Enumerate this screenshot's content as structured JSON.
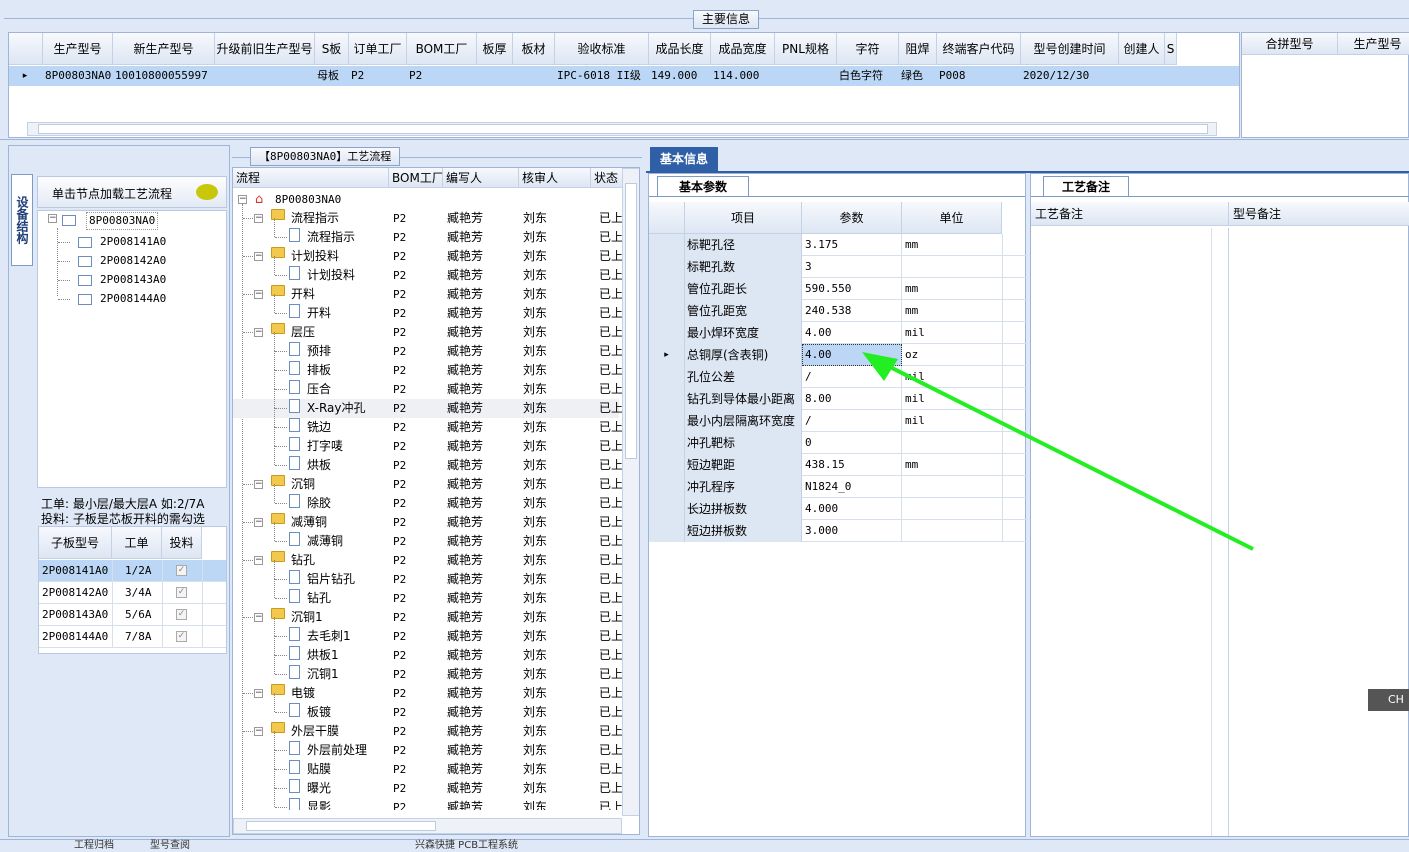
{
  "main_info": {
    "title": "主要信息",
    "columns": [
      "生产型号",
      "新生产型号",
      "升级前旧生产型号",
      "S板",
      "订单工厂",
      "BOM工厂",
      "板厚",
      "板材",
      "验收标准",
      "成品长度",
      "成品宽度",
      "PNL规格",
      "字符",
      "阻焊",
      "终端客户代码",
      "型号创建时间",
      "创建人",
      "S"
    ],
    "row": [
      "8P00803NA0",
      "10010800055997",
      "",
      "母板",
      "P2",
      "P2",
      "",
      "",
      "IPC-6018 II级",
      "149.000",
      "114.000",
      "",
      "白色字符",
      "绿色",
      "P008",
      "2020/12/30",
      "",
      ""
    ],
    "merge_columns": [
      "合拼型号",
      "生产型号"
    ]
  },
  "left": {
    "vtab": "设备结构",
    "hint": "单击节点加载工艺流程",
    "tree_root": "8P00803NA0",
    "tree_children": [
      "2P008141A0",
      "2P008142A0",
      "2P008143A0",
      "2P008144A0"
    ],
    "note1": "工单: 最小层/最大层A 如:2/7A",
    "note2": "投料: 子板是芯板开料的需勾选",
    "sub_headers": [
      "子板型号",
      "工单",
      "投料"
    ],
    "sub_rows": [
      [
        "2P008141A0",
        "1/2A"
      ],
      [
        "2P008142A0",
        "3/4A"
      ],
      [
        "2P008143A0",
        "5/6A"
      ],
      [
        "2P008144A0",
        "7/8A"
      ]
    ]
  },
  "flow": {
    "title": "【8P00803NA0】工艺流程",
    "headers": [
      "流程",
      "BOM工厂",
      "编写人",
      "核审人",
      "状态"
    ],
    "root": "8P00803NA0",
    "rows": [
      {
        "n": "流程指示",
        "l": 1,
        "f": 1
      },
      {
        "n": "流程指示",
        "l": 2
      },
      {
        "n": "计划投料",
        "l": 1,
        "f": 1
      },
      {
        "n": "计划投料",
        "l": 2
      },
      {
        "n": "开料",
        "l": 1,
        "f": 1
      },
      {
        "n": "开料",
        "l": 2
      },
      {
        "n": "层压",
        "l": 1,
        "f": 1
      },
      {
        "n": "预排",
        "l": 2
      },
      {
        "n": "排板",
        "l": 2
      },
      {
        "n": "压合",
        "l": 2
      },
      {
        "n": "X-Ray冲孔",
        "l": 2
      },
      {
        "n": "铣边",
        "l": 2
      },
      {
        "n": "打字唛",
        "l": 2
      },
      {
        "n": "烘板",
        "l": 2
      },
      {
        "n": "沉铜",
        "l": 1,
        "f": 1
      },
      {
        "n": "除胶",
        "l": 2
      },
      {
        "n": "减薄铜",
        "l": 1,
        "f": 1
      },
      {
        "n": "减薄铜",
        "l": 2
      },
      {
        "n": "钻孔",
        "l": 1,
        "f": 1
      },
      {
        "n": "铝片钻孔",
        "l": 2
      },
      {
        "n": "钻孔",
        "l": 2
      },
      {
        "n": "沉铜1",
        "l": 1,
        "f": 1
      },
      {
        "n": "去毛刺1",
        "l": 2
      },
      {
        "n": "烘板1",
        "l": 2
      },
      {
        "n": "沉铜1",
        "l": 2
      },
      {
        "n": "电镀",
        "l": 1,
        "f": 1
      },
      {
        "n": "板镀",
        "l": 2
      },
      {
        "n": "外层干膜",
        "l": 1,
        "f": 1
      },
      {
        "n": "外层前处理",
        "l": 2
      },
      {
        "n": "贴膜",
        "l": 2
      },
      {
        "n": "曝光",
        "l": 2
      },
      {
        "n": "显影",
        "l": 2
      }
    ],
    "bom": "P2",
    "writer": "臧艳芳",
    "reviewer": "刘东",
    "status": "已上"
  },
  "basic": {
    "panel_tab": "基本信息",
    "sub_tab": "基本参数",
    "headers": [
      "项目",
      "参数",
      "单位"
    ],
    "rows": [
      [
        "标靶孔径",
        "3.175",
        "mm"
      ],
      [
        "标靶孔数",
        "3",
        ""
      ],
      [
        "管位孔距长",
        "590.550",
        "mm"
      ],
      [
        "管位孔距宽",
        "240.538",
        "mm"
      ],
      [
        "最小焊环宽度",
        "4.00",
        "mil"
      ],
      [
        "总铜厚(含表铜)",
        "4.00",
        "oz"
      ],
      [
        "孔位公差",
        "/",
        "mil"
      ],
      [
        "钻孔到导体最小距离",
        "8.00",
        "mil"
      ],
      [
        "最小内层隔离环宽度",
        "/",
        "mil"
      ],
      [
        "冲孔靶标",
        "0",
        ""
      ],
      [
        "短边靶距",
        "438.15",
        "mm"
      ],
      [
        "冲孔程序",
        "N1824_0",
        ""
      ],
      [
        "长边拼板数",
        "4.000",
        ""
      ],
      [
        "短边拼板数",
        "3.000",
        ""
      ]
    ]
  },
  "remark": {
    "tab": "工艺备注",
    "col1": "工艺备注",
    "col2": "型号备注"
  },
  "ime": "CH",
  "status_bar": [
    "工程归档",
    "型号查阅",
    "兴森快捷 PCB工程系统"
  ],
  "colors": {
    "arrow": "#22ee22",
    "selected": "#bcd7f5",
    "accent": "#2f5fa7"
  }
}
